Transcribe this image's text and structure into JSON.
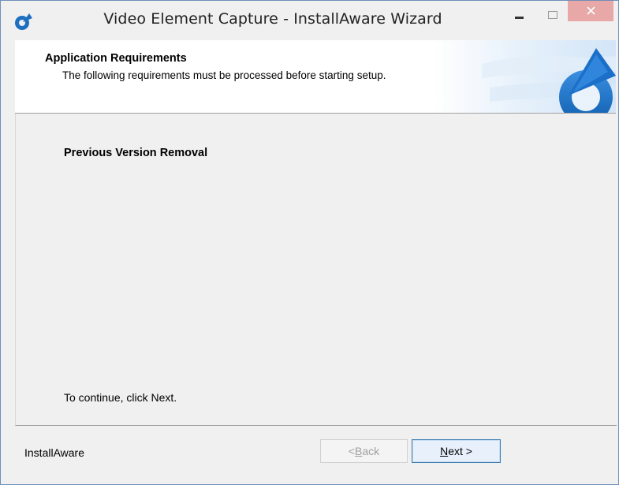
{
  "window": {
    "title": "Video Element Capture - InstallAware Wizard",
    "controls": {
      "minimize": "minimize-icon",
      "maximize": "maximize-icon",
      "close": "close-icon",
      "close_color": "#e9a8a8"
    }
  },
  "header": {
    "title": "Application Requirements",
    "subtitle": "The following requirements must be processed before starting setup."
  },
  "content": {
    "section_title": "Previous Version Removal",
    "continue_text": "To continue, click Next."
  },
  "footer": {
    "brand": "InstallAware",
    "back_prefix": "< ",
    "back_mnemonic": "B",
    "back_rest": "ack",
    "back_enabled": false,
    "next_mnemonic": "N",
    "next_rest": "ext >",
    "next_enabled": true
  },
  "colors": {
    "accent": "#1f7fd6",
    "window_bg": "#f0f0f0"
  }
}
